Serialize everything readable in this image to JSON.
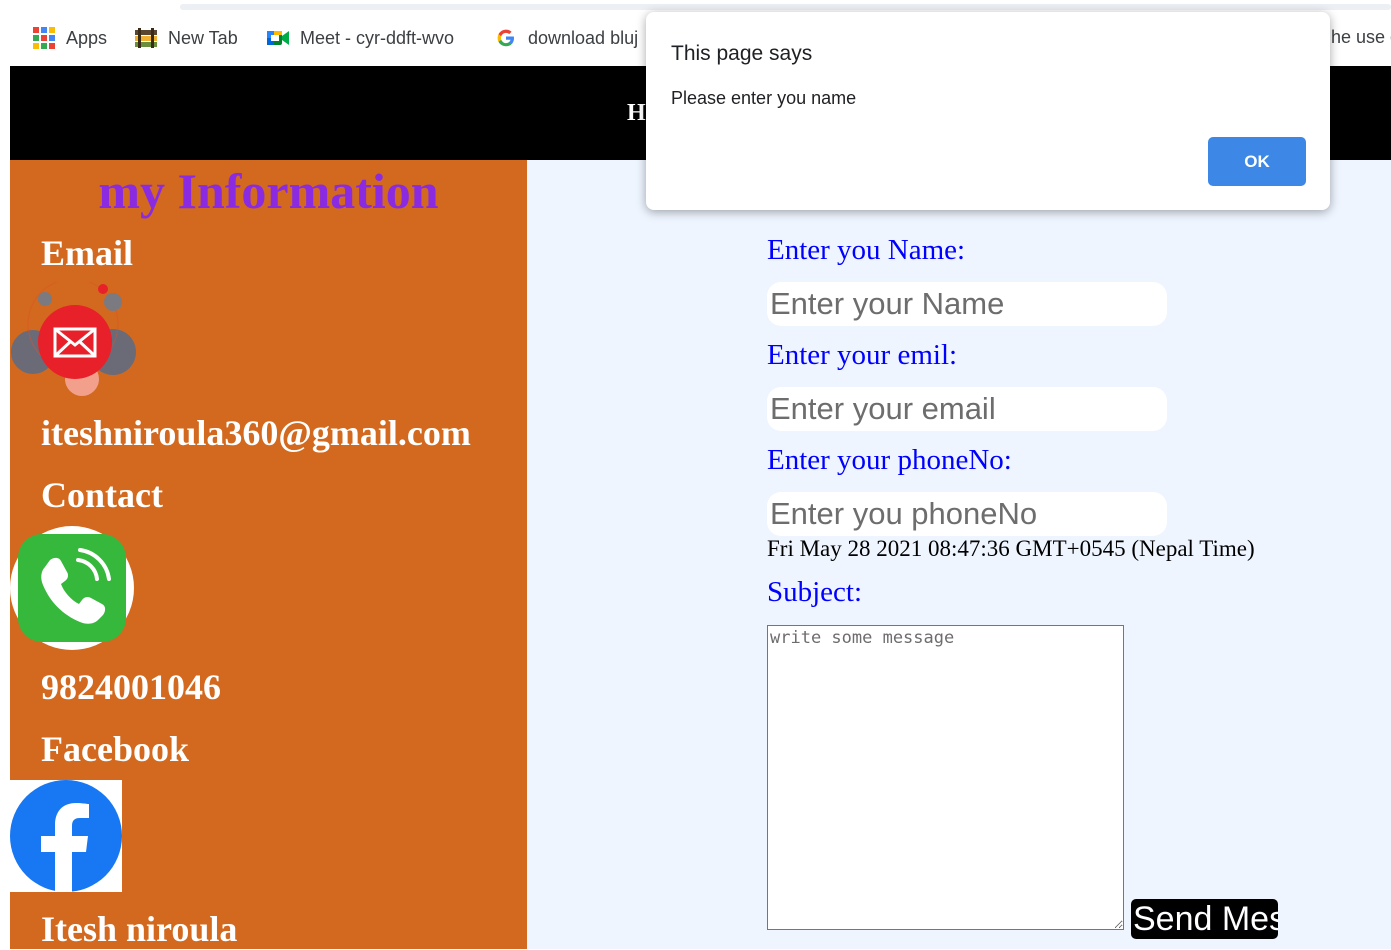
{
  "bookmarks": [
    {
      "label": "Apps",
      "icon": "apps-grid-icon"
    },
    {
      "label": "New Tab",
      "icon": "new-tab-icon"
    },
    {
      "label": "Meet - cyr-ddft-wvo",
      "icon": "google-meet-icon"
    },
    {
      "label": "download bluj",
      "icon": "google-g-icon"
    }
  ],
  "bookmarks_overflow_text": "he use c",
  "header": {
    "text": "H"
  },
  "sidebar": {
    "title": "my Information",
    "email_label": "Email",
    "email_value": "iteshniroula360@gmail.com",
    "contact_label": "Contact",
    "contact_value": "9824001046",
    "facebook_label": "Facebook",
    "facebook_value": "Itesh niroula"
  },
  "form": {
    "name_label": "Enter you Name:",
    "name_placeholder": "Enter your Name",
    "email_label": "Enter your emil:",
    "email_placeholder": "Enter your email",
    "phone_label": "Enter your phoneNo:",
    "phone_placeholder": "Enter you phoneNo",
    "datetime": "Fri May 28 2021 08:47:36 GMT+0545 (Nepal Time)",
    "subject_label": "Subject:",
    "message_placeholder": "write some message",
    "send_label": "Send Message"
  },
  "dialog": {
    "title": "This page says",
    "message": "Please enter you name",
    "ok_label": "OK"
  },
  "colors": {
    "sidebar_bg": "#d2691e",
    "title_purple": "#8a2be2",
    "label_blue": "#0000ff",
    "main_bg": "#eef5ff",
    "ok_blue": "#3d87e6"
  }
}
